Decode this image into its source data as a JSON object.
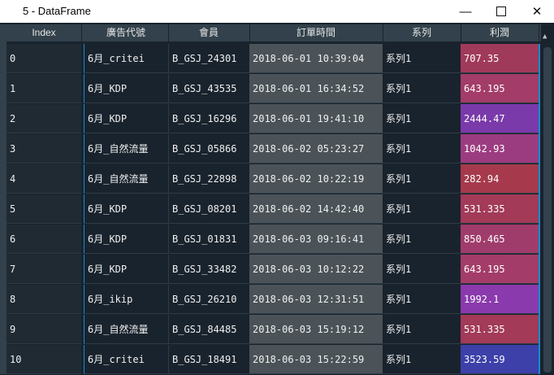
{
  "window": {
    "title": "5 - DataFrame",
    "minimize_glyph": "—",
    "close_glyph": "✕"
  },
  "columns": [
    "Index",
    "廣告代號",
    "會員",
    "訂單時間",
    "系列",
    "利潤"
  ],
  "rows": [
    {
      "index": "0",
      "ad": "6月_critei",
      "member": "B_GSJ_24301",
      "time": "2018-06-01 10:39:04",
      "series": "系列1",
      "profit": "707.35",
      "color": "#a03a5a"
    },
    {
      "index": "1",
      "ad": "6月_KDP",
      "member": "B_GSJ_43535",
      "time": "2018-06-01 16:34:52",
      "series": "系列1",
      "profit": "643.195",
      "color": "#a33c68"
    },
    {
      "index": "2",
      "ad": "6月_KDP",
      "member": "B_GSJ_16296",
      "time": "2018-06-01 19:41:10",
      "series": "系列1",
      "profit": "2444.47",
      "color": "#7a3aaa"
    },
    {
      "index": "3",
      "ad": "6月_自然流量",
      "member": "B_GSJ_05866",
      "time": "2018-06-02 05:23:27",
      "series": "系列1",
      "profit": "1042.93",
      "color": "#9c3c80"
    },
    {
      "index": "4",
      "ad": "6月_自然流量",
      "member": "B_GSJ_22898",
      "time": "2018-06-02 10:22:19",
      "series": "系列1",
      "profit": "282.94",
      "color": "#a63a4c"
    },
    {
      "index": "5",
      "ad": "6月_KDP",
      "member": "B_GSJ_08201",
      "time": "2018-06-02 14:42:40",
      "series": "系列1",
      "profit": "531.335",
      "color": "#a23a58"
    },
    {
      "index": "6",
      "ad": "6月_KDP",
      "member": "B_GSJ_01831",
      "time": "2018-06-03 09:16:41",
      "series": "系列1",
      "profit": "850.465",
      "color": "#a03c6c"
    },
    {
      "index": "7",
      "ad": "6月_KDP",
      "member": "B_GSJ_33482",
      "time": "2018-06-03 10:12:22",
      "series": "系列1",
      "profit": "643.195",
      "color": "#a33c68"
    },
    {
      "index": "8",
      "ad": "6月_ikip",
      "member": "B_GSJ_26210",
      "time": "2018-06-03 12:31:51",
      "series": "系列1",
      "profit": "1992.1",
      "color": "#8a3aac"
    },
    {
      "index": "9",
      "ad": "6月_自然流量",
      "member": "B_GSJ_84485",
      "time": "2018-06-03 15:19:12",
      "series": "系列1",
      "profit": "531.335",
      "color": "#a23a58"
    },
    {
      "index": "10",
      "ad": "6月_critei",
      "member": "B_GSJ_18491",
      "time": "2018-06-03 15:22:59",
      "series": "系列1",
      "profit": "3523.59",
      "color": "#3c40a8"
    }
  ]
}
